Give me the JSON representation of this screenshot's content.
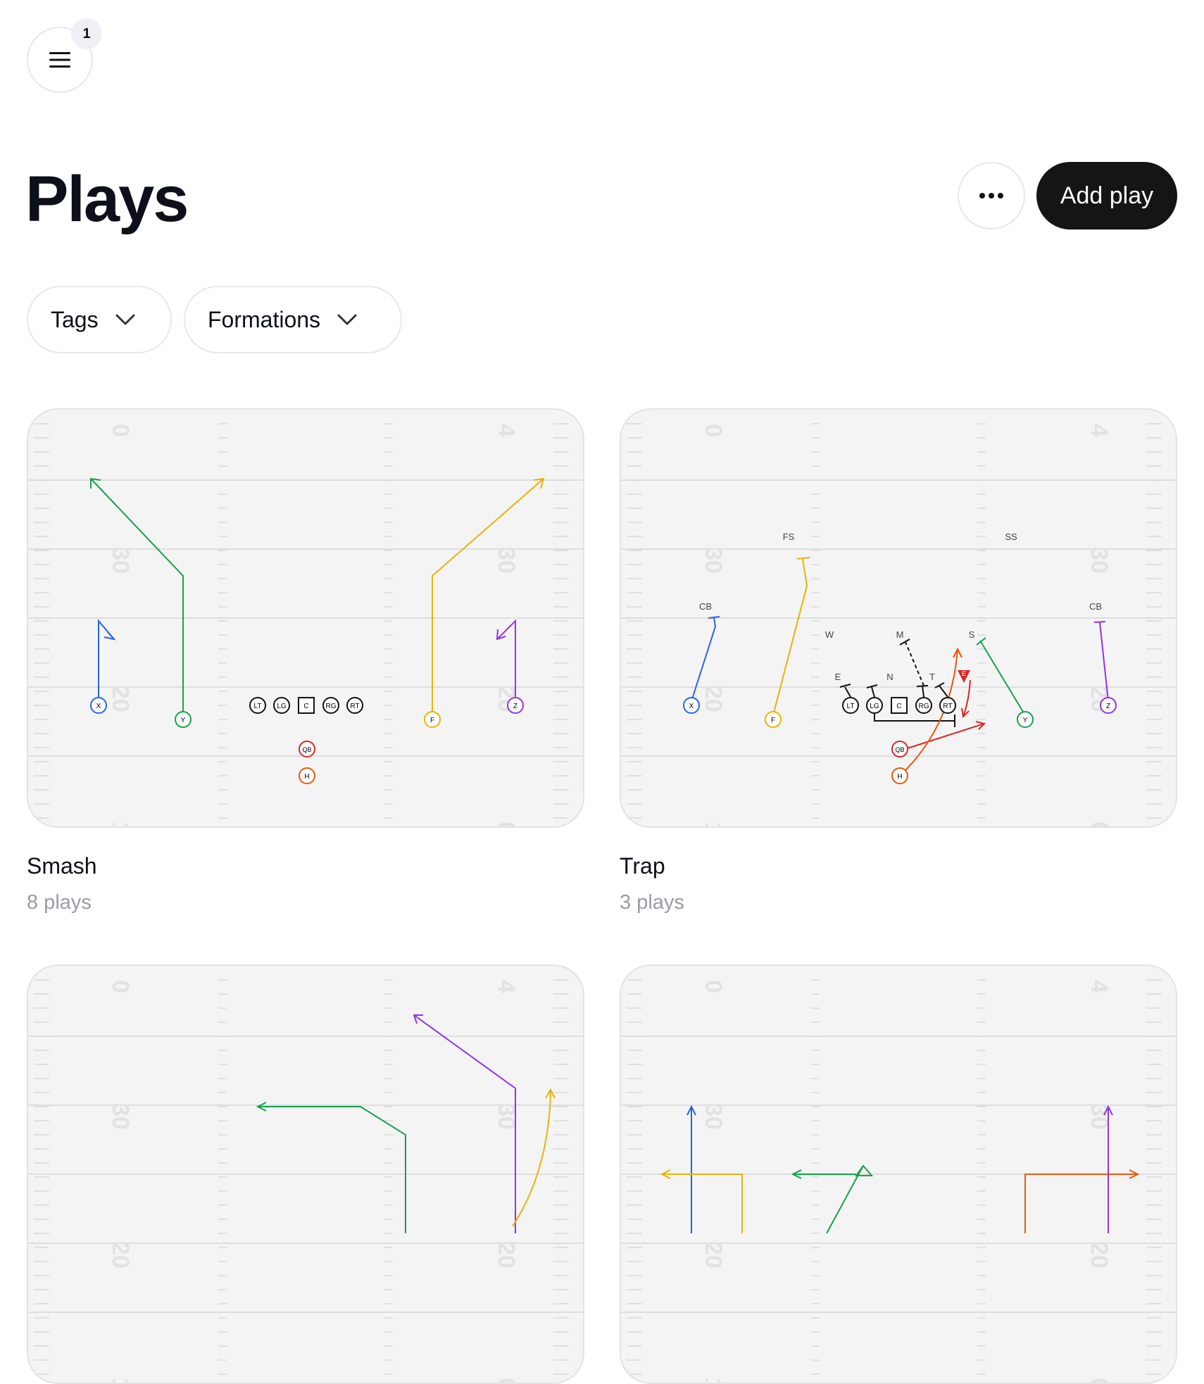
{
  "header": {
    "menu_icon": "hamburger-icon",
    "notification_count": "1"
  },
  "page": {
    "title": "Plays",
    "more_icon": "ellipsis-icon",
    "add_label": "Add play"
  },
  "filters": [
    {
      "label": "Tags",
      "icon": "chevron-down-icon"
    },
    {
      "label": "Formations",
      "icon": "chevron-down-icon"
    }
  ],
  "field": {
    "yard_numbers": [
      "0",
      "30",
      "20",
      "1",
      "4",
      "30",
      "20",
      "0"
    ]
  },
  "plays": [
    {
      "name": "Smash",
      "count": "8 plays",
      "players": [
        "LT",
        "LG",
        "C",
        "RG",
        "RT",
        "QB",
        "H",
        "X",
        "Y",
        "F",
        "Z"
      ]
    },
    {
      "name": "Trap",
      "count": "3 plays",
      "players": [
        "LT",
        "LG",
        "C",
        "RG",
        "RT",
        "QB",
        "H",
        "X",
        "Y",
        "F",
        "Z"
      ],
      "defense": [
        "FS",
        "SS",
        "CB",
        "CB",
        "W",
        "M",
        "S",
        "E",
        "N",
        "T",
        "E"
      ]
    },
    {
      "name": "",
      "count": ""
    },
    {
      "name": "",
      "count": ""
    }
  ],
  "colors": {
    "x": "#2563eb",
    "y": "#16a34a",
    "f": "#eab308",
    "z": "#9333ea",
    "qb": "#dc2626",
    "h": "#ea580c",
    "line": "#111111"
  }
}
